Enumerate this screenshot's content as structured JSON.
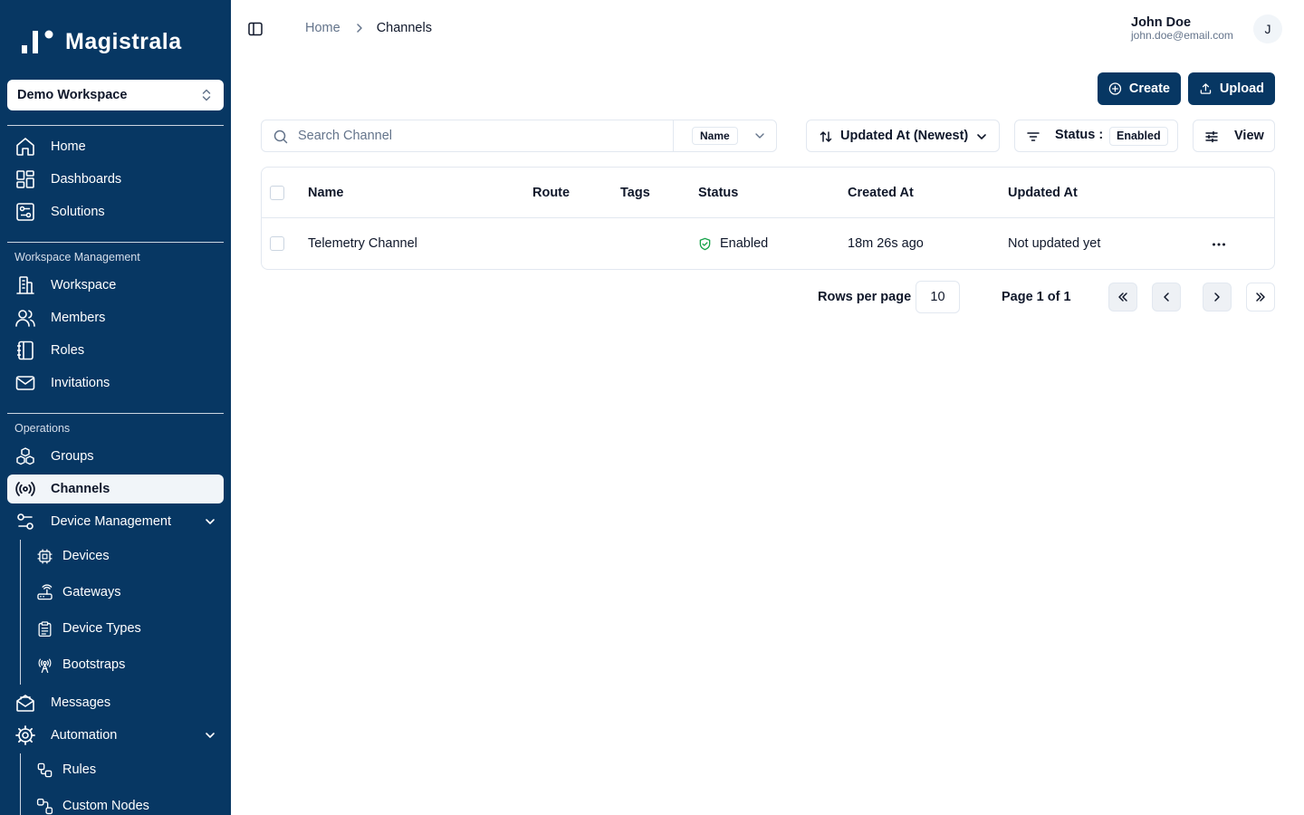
{
  "brand": {
    "name": "Magistrala"
  },
  "workspace": {
    "selected": "Demo Workspace"
  },
  "sidebar": {
    "main_items": [
      {
        "label": "Home",
        "icon": "home-icon"
      },
      {
        "label": "Dashboards",
        "icon": "dashboard-icon"
      },
      {
        "label": "Solutions",
        "icon": "solutions-icon"
      }
    ],
    "workspace_section": {
      "title": "Workspace Management",
      "items": [
        {
          "label": "Workspace",
          "icon": "building-icon"
        },
        {
          "label": "Members",
          "icon": "users-icon"
        },
        {
          "label": "Roles",
          "icon": "notebook-icon"
        },
        {
          "label": "Invitations",
          "icon": "mail-icon"
        }
      ]
    },
    "operations_section": {
      "title": "Operations",
      "items": [
        {
          "label": "Groups",
          "icon": "boxes-icon"
        },
        {
          "label": "Channels",
          "icon": "radio-icon",
          "active": true
        },
        {
          "label": "Device Management",
          "icon": "settings-sliders-icon",
          "expanded": true
        },
        {
          "label": "Messages",
          "icon": "mail-open-icon"
        },
        {
          "label": "Automation",
          "icon": "cog-icon",
          "expanded": true
        }
      ],
      "device_subitems": [
        {
          "label": "Devices",
          "icon": "cpu-icon"
        },
        {
          "label": "Gateways",
          "icon": "router-icon"
        },
        {
          "label": "Device Types",
          "icon": "clipboard-icon"
        },
        {
          "label": "Bootstraps",
          "icon": "antenna-icon"
        }
      ],
      "automation_subitems": [
        {
          "label": "Rules",
          "icon": "workflow-icon"
        },
        {
          "label": "Custom Nodes",
          "icon": "nodes-icon"
        }
      ]
    }
  },
  "header": {
    "breadcrumb": {
      "home": "Home",
      "current": "Channels"
    },
    "user": {
      "name": "John Doe",
      "email": "john.doe@email.com",
      "initial": "J"
    }
  },
  "actions": {
    "create_label": "Create",
    "upload_label": "Upload"
  },
  "filters": {
    "search_placeholder": "Search Channel",
    "search_field": "Name",
    "sort_label": "Updated At (Newest)",
    "status_label": "Status :",
    "status_value": "Enabled",
    "view_label": "View"
  },
  "table": {
    "columns": [
      "Name",
      "Route",
      "Tags",
      "Status",
      "Created At",
      "Updated At"
    ],
    "rows": [
      {
        "name": "Telemetry Channel",
        "route": "",
        "tags": "",
        "status": "Enabled",
        "created_at": "18m 26s ago",
        "updated_at": "Not updated yet"
      }
    ]
  },
  "pagination": {
    "rows_label": "Rows per page",
    "rows_value": "10",
    "page_label": "Page 1 of 1"
  },
  "colors": {
    "sidebar_bg": "#073763",
    "primary": "#073763",
    "status_enabled": "#16a34a"
  }
}
